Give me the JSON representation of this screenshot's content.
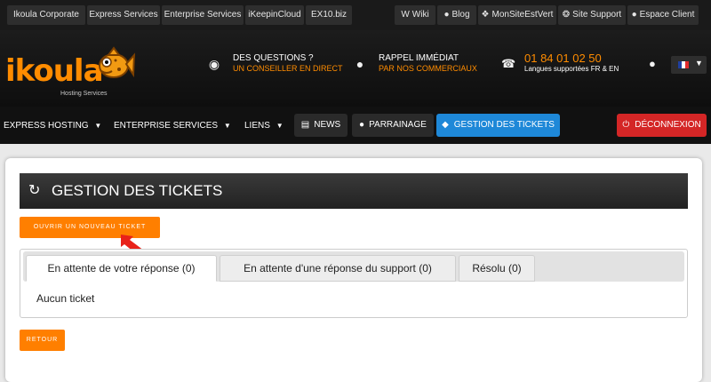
{
  "topbar": {
    "links": [
      {
        "label": "Ikoula Corporate"
      },
      {
        "label": "Express Services"
      },
      {
        "label": "Enterprise Services"
      },
      {
        "label": "iKeepinCloud"
      },
      {
        "label": "EX10.biz"
      }
    ],
    "right_links": [
      {
        "label": "Wiki",
        "icon": "wikipedia-icon"
      },
      {
        "label": "Blog",
        "icon": "comments-icon"
      },
      {
        "label": "MonSiteEstVert",
        "icon": "leaf-icon"
      },
      {
        "label": "Site Support",
        "icon": "lifebuoy-icon"
      },
      {
        "label": "Espace Client",
        "icon": "user-icon"
      }
    ]
  },
  "header": {
    "logo_text": "ikoula",
    "logo_sub": "Hosting Services",
    "questions": {
      "line1": "DES QUESTIONS ?",
      "line2": "UN CONSEILLER EN DIRECT"
    },
    "callback": {
      "line1": "RAPPEL IMMÉDIAT",
      "line2": "PAR NOS COMMERCIAUX"
    },
    "phone": {
      "number": "01 84 01 02 50",
      "sub": "Langues supportées FR & EN"
    }
  },
  "nav": {
    "express": "EXPRESS HOSTING",
    "enterprise": "ENTERPRISE SERVICES",
    "liens": "LIENS",
    "news": "NEWS",
    "parrainage": "PARRAINAGE",
    "tickets": "GESTION DES TICKETS",
    "logout": "DÉCONNEXION"
  },
  "main": {
    "title": "GESTION DES TICKETS",
    "new_ticket": "OUVRIR UN NOUVEAU TICKET",
    "tabs": [
      {
        "label": "En attente de votre réponse (0)",
        "active": true
      },
      {
        "label": "En attente d'une réponse du support (0)",
        "active": false
      },
      {
        "label": "Résolu (0)",
        "active": false
      }
    ],
    "empty": "Aucun ticket",
    "back": "RETOUR"
  },
  "colors": {
    "accent": "#ff7f00",
    "nav_active": "#1e88d8",
    "logout": "#d42626"
  }
}
